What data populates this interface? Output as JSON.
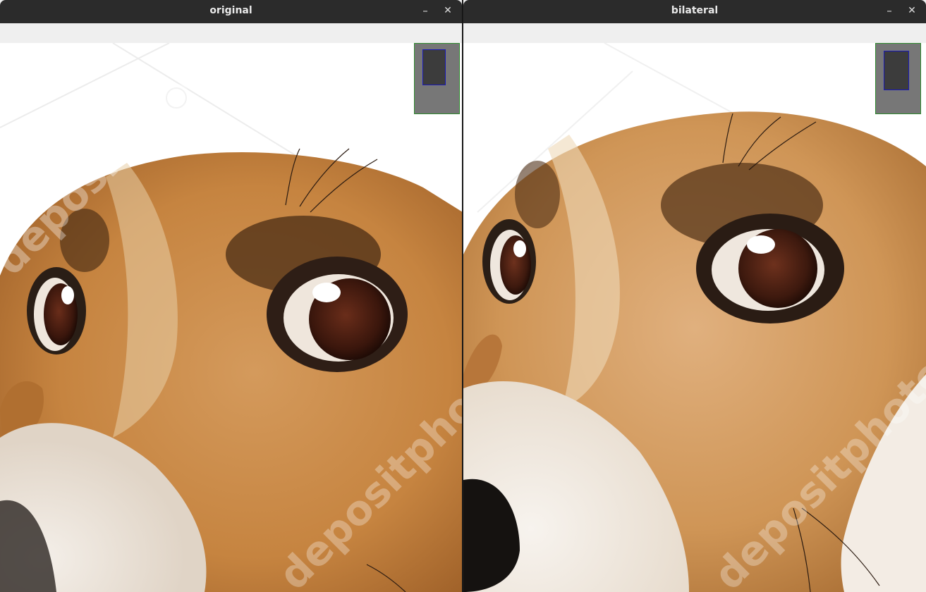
{
  "windows": [
    {
      "title": "original",
      "minimize_glyph": "–",
      "close_glyph": "✕"
    },
    {
      "title": "bilateral",
      "minimize_glyph": "–",
      "close_glyph": "✕"
    }
  ],
  "images": [
    {
      "description_icon": "photo-dog-face-original",
      "watermark": "depositphotos"
    },
    {
      "description_icon": "photo-dog-face-bilateral",
      "watermark": "depositphotos"
    }
  ],
  "colors": {
    "titlebar": "#2b2b2b",
    "fur_orange": "#c98843",
    "minimap_bg": "#777777",
    "minimap_border": "#2f8a2f",
    "viewport_border": "#1a1ab8"
  }
}
